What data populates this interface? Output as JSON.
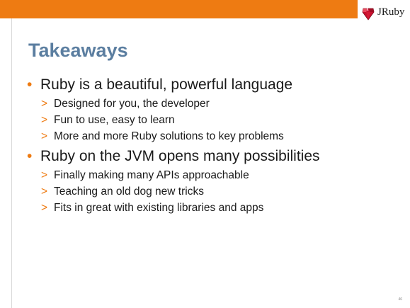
{
  "header": {
    "logo_text": "JRuby"
  },
  "title": "Takeaways",
  "bullets": [
    {
      "text": "Ruby is a beautiful, powerful language",
      "subs": [
        "Designed for you, the developer",
        "Fun to use, easy to learn",
        "More and more Ruby solutions to key problems"
      ]
    },
    {
      "text": "Ruby on the JVM opens many possibilities",
      "subs": [
        "Finally making many APIs approachable",
        "Teaching an old dog new tricks",
        "Fits in great with existing libraries and apps"
      ]
    }
  ],
  "markers": {
    "bullet": "•",
    "sub": ">"
  },
  "page_number": "46",
  "colors": {
    "accent": "#ee7b12",
    "title": "#5b7ea0",
    "text": "#1a1a1a"
  }
}
